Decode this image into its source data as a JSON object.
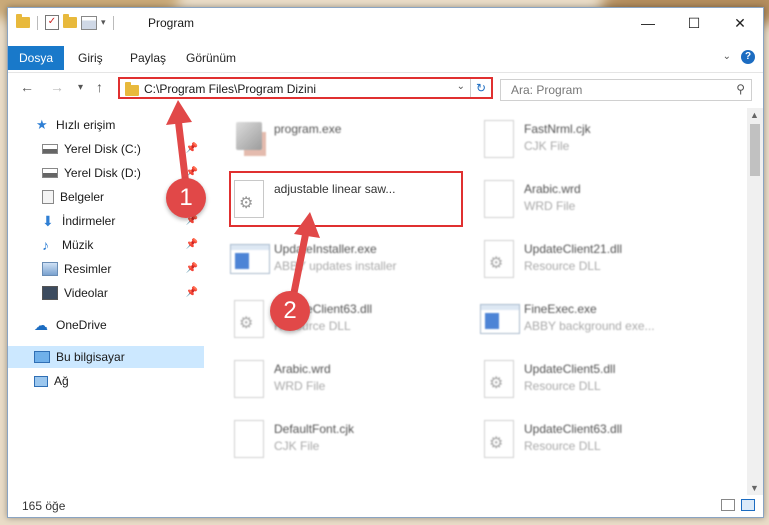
{
  "window": {
    "title": "Program",
    "buttons": {
      "minimize": "—",
      "maximize": "☐",
      "close": "✕"
    }
  },
  "ribbon": {
    "file_tab": "Dosya",
    "tabs": [
      "Giriş",
      "Paylaş",
      "Görünüm"
    ],
    "help": "?"
  },
  "nav": {
    "back": "←",
    "forward": "→",
    "recent": "▾",
    "up": "↑",
    "address": "C:\\Program Files\\Program Dizini",
    "search_placeholder": "Ara: Program"
  },
  "sidebar": {
    "items": [
      {
        "label": "Hızlı erişim",
        "icon": "star-icon"
      },
      {
        "label": "Yerel Disk (C:)",
        "icon": "drive-icon",
        "pinned": true
      },
      {
        "label": "Yerel Disk (D:)",
        "icon": "drive-icon",
        "pinned": true
      },
      {
        "label": "Belgeler",
        "icon": "documents-icon",
        "pinned": true
      },
      {
        "label": "İndirmeler",
        "icon": "download-icon",
        "pinned": true
      },
      {
        "label": "Müzik",
        "icon": "music-icon",
        "pinned": true
      },
      {
        "label": "Resimler",
        "icon": "pictures-icon",
        "pinned": true
      },
      {
        "label": "Videolar",
        "icon": "videos-icon",
        "pinned": true
      },
      {
        "label": "OneDrive",
        "icon": "onedrive-icon"
      },
      {
        "label": "Bu bilgisayar",
        "icon": "computer-icon",
        "selected": true
      },
      {
        "label": "Ağ",
        "icon": "network-icon"
      }
    ]
  },
  "files": [
    {
      "name": "program.exe",
      "type": ""
    },
    {
      "name": "FastNrml.cjk",
      "type": "CJK File"
    },
    {
      "name": "adjustable linear saw...",
      "type": ""
    },
    {
      "name": "Arabic.wrd",
      "type": "WRD File"
    },
    {
      "name": "UpdateInstaller.exe",
      "type": "ABBY updates installer"
    },
    {
      "name": "UpdateClient21.dll",
      "type": "Resource DLL"
    },
    {
      "name": "UpdateClient63.dll",
      "type": "Resource DLL"
    },
    {
      "name": "FineExec.exe",
      "type": "ABBY background exe..."
    },
    {
      "name": "Arabic.wrd",
      "type": "WRD File"
    },
    {
      "name": "UpdateClient5.dll",
      "type": "Resource DLL"
    },
    {
      "name": "DefaultFont.cjk",
      "type": "CJK File"
    },
    {
      "name": "UpdateClient63.dll",
      "type": "Resource DLL"
    }
  ],
  "status": {
    "count": "165 öğe"
  },
  "callouts": [
    "1",
    "2"
  ],
  "colors": {
    "accent": "#1979ca",
    "highlight": "#e03030",
    "badge": "#e14848"
  }
}
